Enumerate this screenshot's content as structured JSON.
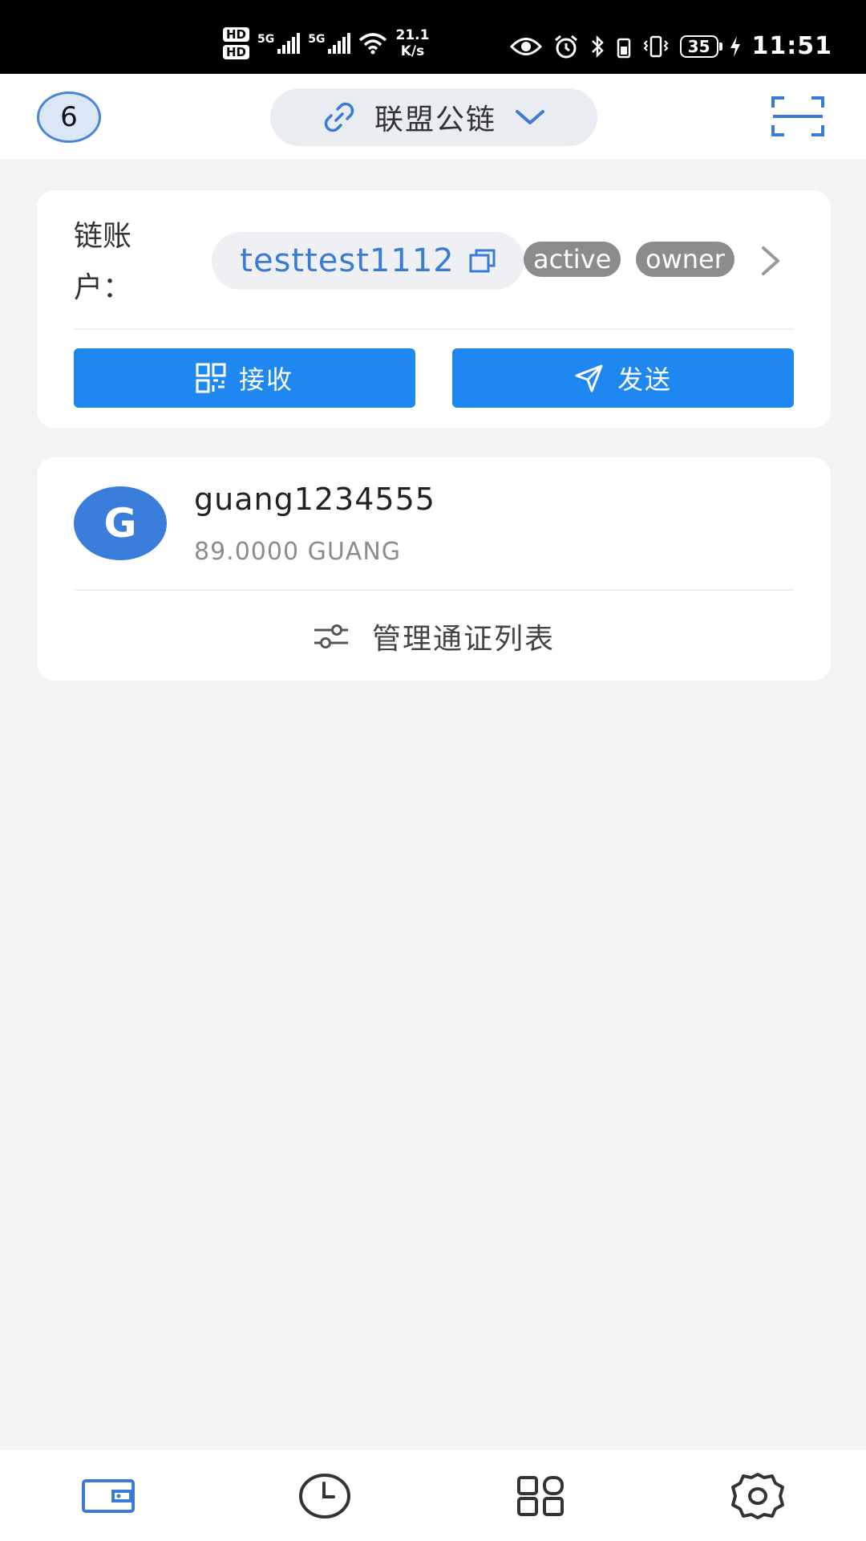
{
  "status_bar": {
    "hd1": "HD",
    "hd2": "HD",
    "network1": "5G",
    "network2": "5G",
    "speed_value": "21.1",
    "speed_unit": "K/s",
    "battery": "35",
    "time": "11:51"
  },
  "header": {
    "account_count": "6",
    "chain_name": "联盟公链",
    "icons": {
      "chain": "link-icon",
      "dropdown": "chevron-down-icon",
      "scan": "scan-icon"
    }
  },
  "account": {
    "label": "链账户：",
    "name": "testtest1112",
    "tags": [
      "active",
      "owner"
    ],
    "receive_label": "接收",
    "send_label": "发送"
  },
  "token": {
    "avatar_letter": "G",
    "name": "guang1234555",
    "balance": "89.0000 GUANG",
    "manage_label": "管理通证列表"
  },
  "bottom_nav": {
    "items": [
      {
        "icon": "wallet-icon",
        "active": true
      },
      {
        "icon": "clock-icon",
        "active": false
      },
      {
        "icon": "apps-grid-icon",
        "active": false
      },
      {
        "icon": "settings-gear-icon",
        "active": false
      }
    ]
  },
  "colors": {
    "accent": "#1e88f0",
    "link_text": "#3a7bd5",
    "tag_bg": "#8c8c8c",
    "page_bg": "#f2f3f5"
  }
}
